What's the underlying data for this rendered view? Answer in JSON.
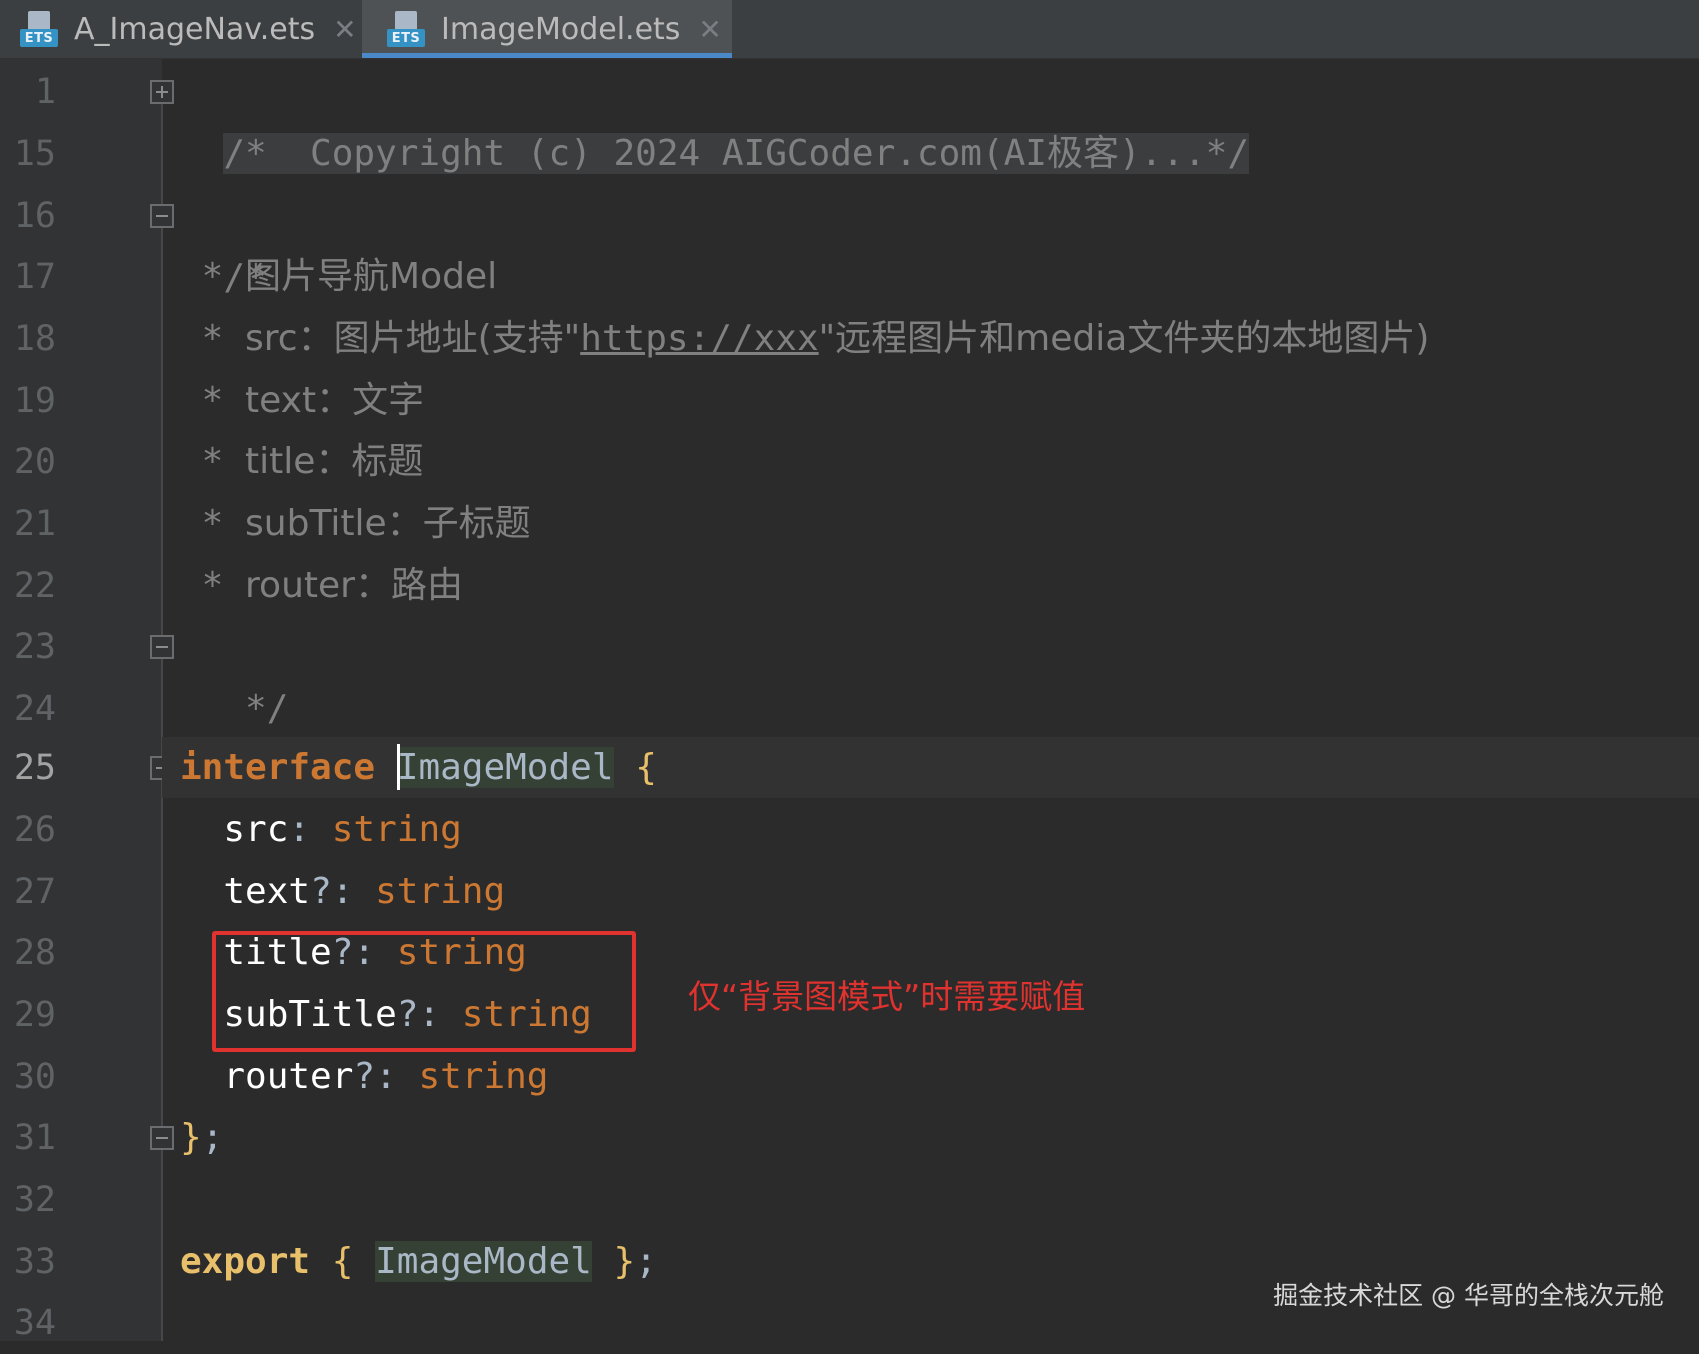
{
  "tabs": [
    {
      "icon": "ets-file-icon",
      "icon_badge": "ETS",
      "label": "A_ImageNav.ets",
      "active": false
    },
    {
      "icon": "ets-file-icon",
      "icon_badge": "ETS",
      "label": "ImageModel.ets",
      "active": true
    }
  ],
  "tab_close_glyph": "✕",
  "line_numbers": [
    "1",
    "15",
    "16",
    "17",
    "18",
    "19",
    "20",
    "21",
    "22",
    "23",
    "24",
    "25",
    "26",
    "27",
    "28",
    "29",
    "30",
    "31",
    "32",
    "33",
    "34"
  ],
  "current_line": "25",
  "code": {
    "l1": "/*  Copyright (c) 2024 AIGCoder.com(AI极客)...*/",
    "l16": "/*",
    "l17_star": " * ",
    "l17_text": "图片导航Model",
    "l18_star": " * ",
    "l18_pre": "src：图片地址(支持\"",
    "l18_link": "https://xxx",
    "l18_post": "\"远程图片和media文件夹的本地图片)",
    "l19_star": " * ",
    "l19_text": "text：文字",
    "l20_star": " * ",
    "l20_text": "title：标题",
    "l21_star": " * ",
    "l21_text": "subTitle：子标题",
    "l22_star": " * ",
    "l22_text": "router：路由",
    "l23": " */",
    "l25_kw": "interface",
    "l25_name": "ImageModel",
    "l25_brace": "{",
    "props": [
      {
        "name": "src",
        "sep": ": ",
        "type": "string"
      },
      {
        "name": "text",
        "sep": "?: ",
        "type": "string"
      },
      {
        "name": "title",
        "sep": "?: ",
        "type": "string"
      },
      {
        "name": "subTitle",
        "sep": "?: ",
        "type": "string"
      },
      {
        "name": "router",
        "sep": "?: ",
        "type": "string"
      }
    ],
    "l31_brace": "}",
    "l31_semi": ";",
    "l33_kw": "export",
    "l33_open": "{",
    "l33_name": "ImageModel",
    "l33_close": "}",
    "l33_semi": ";"
  },
  "annotation": "仅“背景图模式”时需要赋值",
  "watermark": "掘金技术社区 @ 华哥的全栈次元舱",
  "colors": {
    "background": "#2b2b2b",
    "keyword": "#cc7832",
    "comment": "#808080",
    "annotation_red": "#e0322e",
    "tab_active_underline": "#4a88c7"
  }
}
